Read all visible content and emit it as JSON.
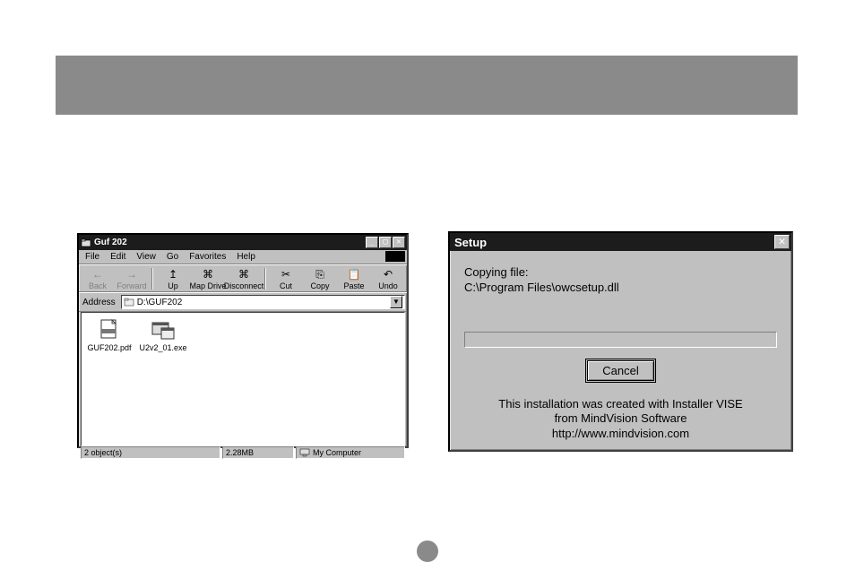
{
  "explorer": {
    "title": "Guf 202",
    "menus": [
      "File",
      "Edit",
      "View",
      "Go",
      "Favorites",
      "Help"
    ],
    "toolbar": [
      {
        "name": "back-button",
        "label": "Back",
        "glyph": "←",
        "disabled": true
      },
      {
        "name": "forward-button",
        "label": "Forward",
        "glyph": "→",
        "disabled": true
      },
      {
        "name": "up-button",
        "label": "Up",
        "glyph": "↥",
        "disabled": false
      },
      {
        "name": "map-drive-button",
        "label": "Map Drive",
        "glyph": "⌘",
        "disabled": false
      },
      {
        "name": "disconnect-button",
        "label": "Disconnect",
        "glyph": "⌘",
        "disabled": false
      },
      {
        "name": "cut-button",
        "label": "Cut",
        "glyph": "✂",
        "disabled": false
      },
      {
        "name": "copy-button",
        "label": "Copy",
        "glyph": "⎘",
        "disabled": false
      },
      {
        "name": "paste-button",
        "label": "Paste",
        "glyph": "📋",
        "disabled": false
      },
      {
        "name": "undo-button",
        "label": "Undo",
        "glyph": "↶",
        "disabled": false
      }
    ],
    "address_label": "Address",
    "address_value": "D:\\GUF202",
    "files": [
      {
        "name": "pdf-file-icon",
        "label": "GUF202.pdf",
        "icon": "pdf"
      },
      {
        "name": "exe-file-icon",
        "label": "U2v2_01.exe",
        "icon": "exe"
      }
    ],
    "status": {
      "objects": "2 object(s)",
      "size": "2.28MB",
      "location": "My Computer"
    }
  },
  "setup": {
    "title": "Setup",
    "copying_label": "Copying file:",
    "copying_path": "C:\\Program Files\\owcsetup.dll",
    "cancel_label": "Cancel",
    "credits_line1": "This installation was created with Installer VISE",
    "credits_line2": "from MindVision Software",
    "credits_line3": "http://www.mindvision.com"
  }
}
